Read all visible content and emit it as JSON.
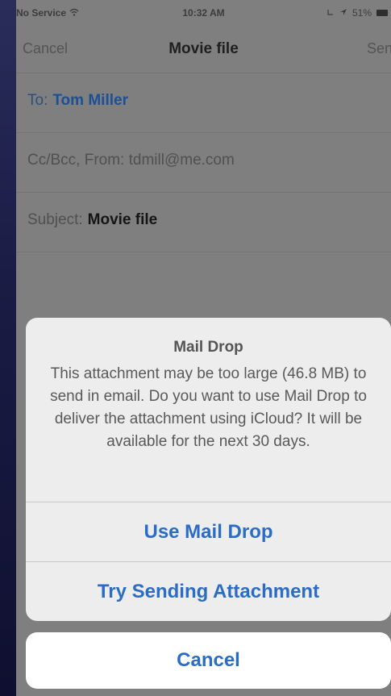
{
  "status_bar": {
    "carrier": "No Service",
    "wifi_icon": "wifi-icon",
    "time": "10:32 AM",
    "battery_percent": "51%",
    "location_icon": "location-arrow-icon",
    "battery_icon": "battery-icon"
  },
  "nav": {
    "cancel_label": "Cancel",
    "title": "Movie file",
    "send_label": "Send"
  },
  "fields": {
    "to_label": "To:",
    "to_value": "Tom Miller",
    "cc_text": "Cc/Bcc, From: tdmill@me.com",
    "subject_label": "Subject:",
    "subject_value": "Movie file"
  },
  "alert": {
    "title": "Mail Drop",
    "message": "This attachment may be too large (46.8 MB) to send in email. Do you want to use Mail Drop to deliver the attachment using iCloud? It will be available for the next 30 days.",
    "action_primary": "Use Mail Drop",
    "action_secondary": "Try Sending Attachment"
  },
  "cancel_sheet": {
    "label": "Cancel"
  },
  "colors": {
    "accent": "#2a6cc6",
    "dim_background": "#7f7f7f",
    "sheet_background": "#ededed"
  }
}
